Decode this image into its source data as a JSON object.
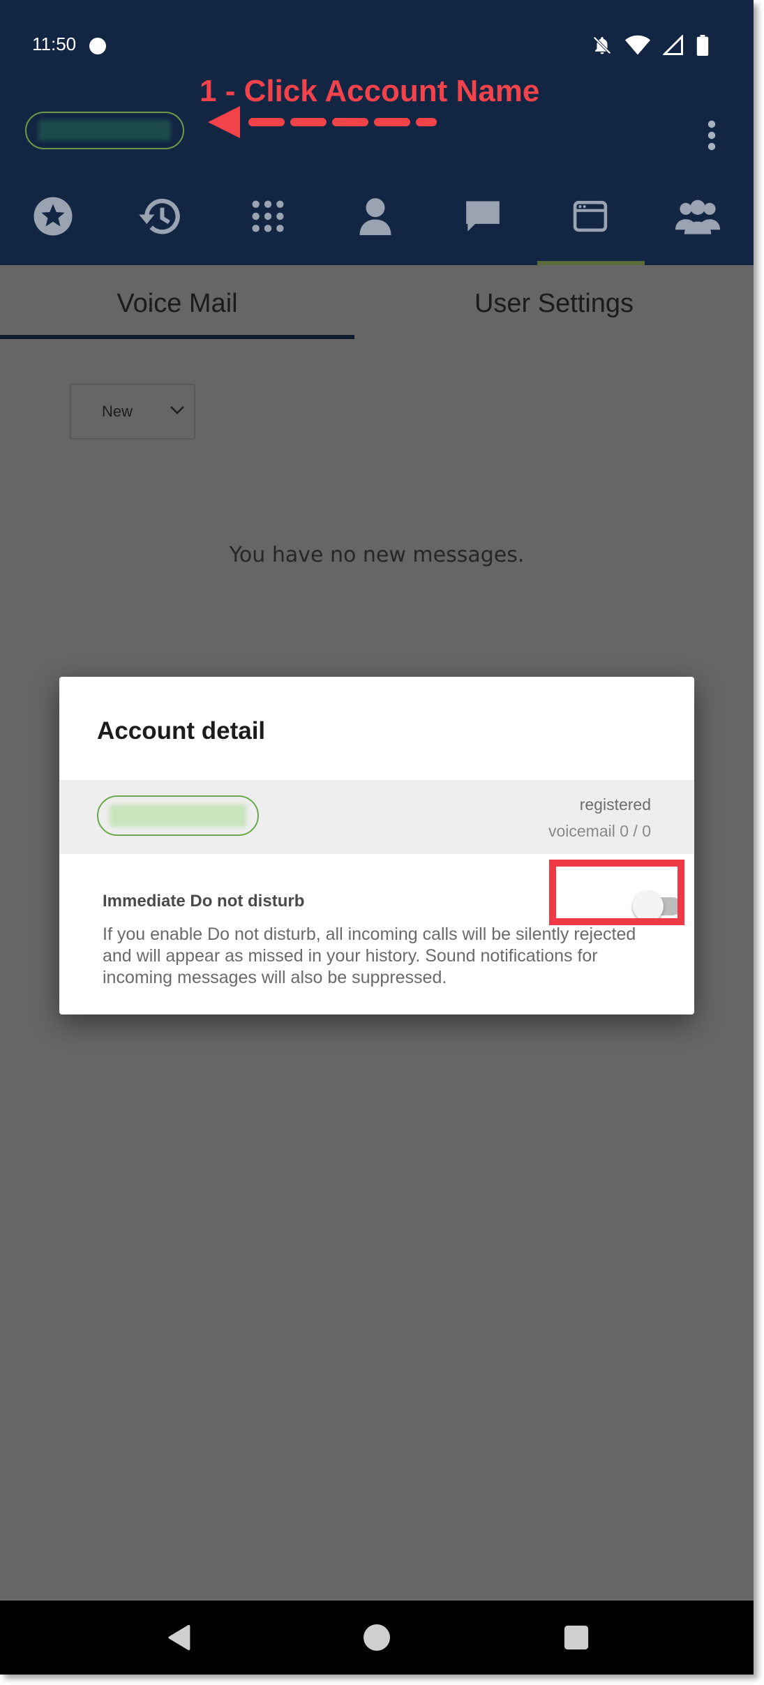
{
  "status_bar": {
    "time": "11:50"
  },
  "annotation": {
    "step_label": "1 - Click Account Name",
    "color": "#f2434b"
  },
  "header": {
    "background": "#122543",
    "nav_icons": [
      "star-icon",
      "history-icon",
      "dialpad-icon",
      "contact-icon",
      "chat-icon",
      "voicemail-window-icon",
      "groups-icon"
    ],
    "active_nav_index": 5
  },
  "tabs": [
    {
      "label": "Voice Mail",
      "active": true
    },
    {
      "label": "User Settings",
      "active": false
    }
  ],
  "voicemail": {
    "filter_selected": "New",
    "empty_message": "You have no new messages."
  },
  "dialog": {
    "title": "Account detail",
    "account_status": "registered",
    "voicemail_count": "voicemail 0 / 0",
    "dnd_title": "Immediate Do not disturb",
    "dnd_description": "If you enable Do not disturb, all incoming calls will be silently rejected and will appear as missed in your history. Sound notifications for incoming messages will also be suppressed.",
    "dnd_enabled": false,
    "highlight_color": "#ef3a45"
  }
}
